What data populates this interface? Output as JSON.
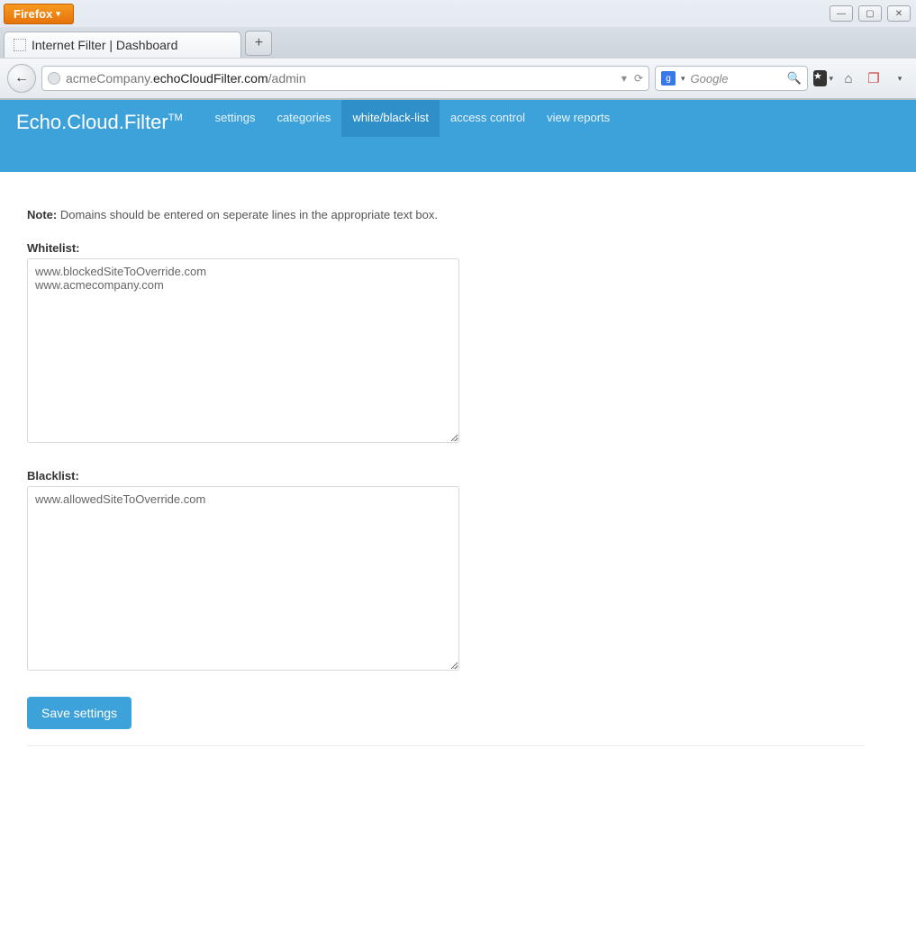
{
  "browser": {
    "app_button": "Firefox",
    "tab_title": "Internet Filter | Dashboard",
    "url_prefix": "acmeCompany.",
    "url_bold": "echoCloudFilter.com",
    "url_suffix": "/admin",
    "search_placeholder": "Google"
  },
  "header": {
    "brand": "Echo.Cloud.Filter",
    "brand_tm": "TM",
    "menu": [
      "settings",
      "categories",
      "white/black-list",
      "access control",
      "view reports"
    ],
    "active_index": 2
  },
  "page": {
    "note_label": "Note:",
    "note_text": "Domains should be entered on seperate lines in the appropriate text box.",
    "whitelist_label": "Whitelist:",
    "whitelist_value": "www.blockedSiteToOverride.com\nwww.acmecompany.com",
    "blacklist_label": "Blacklist:",
    "blacklist_value": "www.allowedSiteToOverride.com",
    "save_label": "Save settings"
  }
}
